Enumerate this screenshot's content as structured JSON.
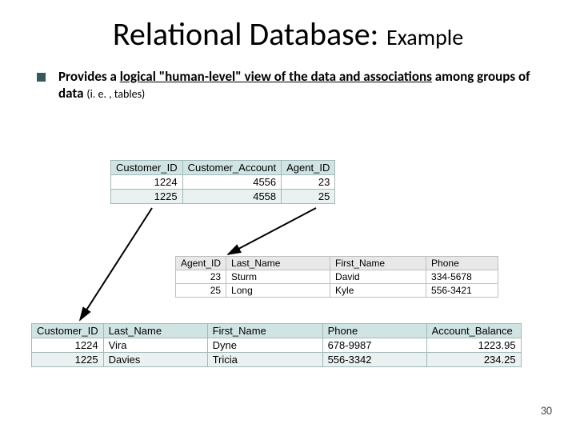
{
  "title": {
    "main": "Relational Database:",
    "sub": "Example"
  },
  "bullet": {
    "prefix": "Provides a ",
    "underlined": "logical \"human-level\" view of the data and associations",
    "suffix": " among groups of data ",
    "paren": "(i. e. , tables)"
  },
  "tables": {
    "customer_agent": {
      "headers": [
        "Customer_ID",
        "Customer_Account",
        "Agent_ID"
      ],
      "rows": [
        {
          "id": "1224",
          "acct": "4556",
          "agent": "23"
        },
        {
          "id": "1225",
          "acct": "4558",
          "agent": "25"
        }
      ]
    },
    "agent": {
      "headers": [
        "Agent_ID",
        "Last_Name",
        "First_Name",
        "Phone"
      ],
      "rows": [
        {
          "id": "23",
          "last": "Sturm",
          "first": "David",
          "phone": "334-5678"
        },
        {
          "id": "25",
          "last": "Long",
          "first": "Kyle",
          "phone": "556-3421"
        }
      ]
    },
    "customer": {
      "headers": [
        "Customer_ID",
        "Last_Name",
        "First_Name",
        "Phone",
        "Account_Balance"
      ],
      "rows": [
        {
          "id": "1224",
          "last": "Vira",
          "first": "Dyne",
          "phone": "678-9987",
          "bal": "1223.95"
        },
        {
          "id": "1225",
          "last": "Davies",
          "first": "Tricia",
          "phone": "556-3342",
          "bal": "234.25"
        }
      ]
    }
  },
  "page_number": "30"
}
